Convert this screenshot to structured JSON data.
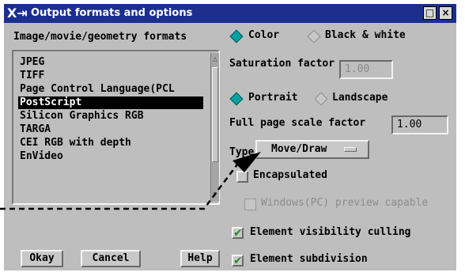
{
  "window": {
    "title": "Output formats and options",
    "logo_glyph": "X⇥",
    "minimize_glyph": "□",
    "close_glyph": "×"
  },
  "formats": {
    "label": "Image/movie/geometry formats",
    "items": [
      "JPEG",
      "TIFF",
      "Page Control Language(PCL",
      "PostScript",
      "Silicon Graphics RGB",
      "TARGA",
      "CEI RGB with depth",
      "EnVideo"
    ],
    "selected": "PostScript"
  },
  "color_mode": {
    "options": [
      "Color",
      "Black & white"
    ],
    "selected": "Color"
  },
  "saturation": {
    "label": "Saturation factor",
    "value": "1.00",
    "enabled": false
  },
  "orientation": {
    "options": [
      "Portrait",
      "Landscape"
    ],
    "selected": "Portrait"
  },
  "scale": {
    "label": "Full page scale factor",
    "value": "1.00"
  },
  "type": {
    "label": "Type",
    "value": "Move/Draw"
  },
  "checkboxes": {
    "encapsulated": {
      "label": "Encapsulated",
      "checked": false
    },
    "windows_preview": {
      "label": "Windows(PC) preview capable",
      "enabled": false
    },
    "visibility_culling": {
      "label": "Element visibility culling",
      "checked": true
    },
    "subdivision": {
      "label": "Element subdivision",
      "checked": true
    }
  },
  "buttons": {
    "okay": "Okay",
    "cancel": "Cancel",
    "help": "Help"
  },
  "glyphs": {
    "check": "✔",
    "arrow_up": "△",
    "arrow_down": "▽"
  },
  "colors": {
    "titlebar": "#1c2f8f",
    "radio_on": "#00a2a2",
    "check": "#2a8a2a",
    "panel": "#bebebe"
  }
}
